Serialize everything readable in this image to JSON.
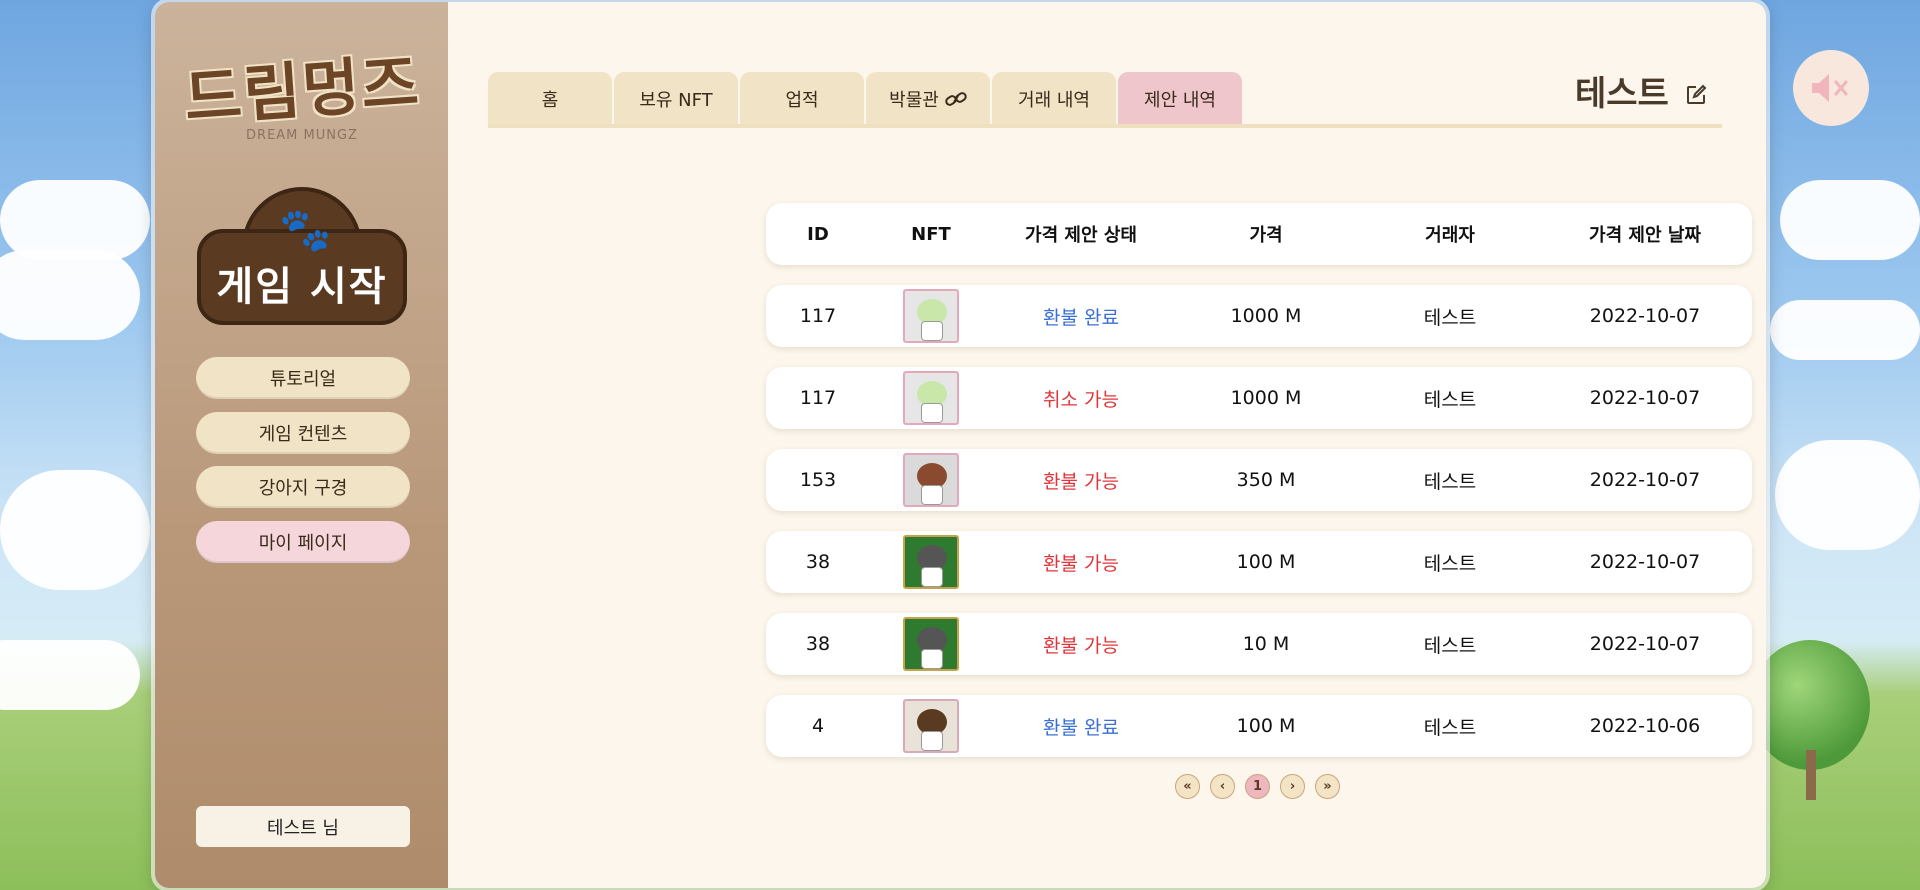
{
  "logo": {
    "text": "드림멍즈",
    "subtitle": "DREAM MUNGZ"
  },
  "sidebar": {
    "game_start_label": "게임 시작",
    "items": [
      {
        "label": "튜토리얼"
      },
      {
        "label": "게임 컨텐츠"
      },
      {
        "label": "강아지 구경"
      },
      {
        "label": "마이 페이지"
      }
    ],
    "user_label": "테스트 님"
  },
  "tabs": [
    {
      "label": "홈"
    },
    {
      "label": "보유 NFT"
    },
    {
      "label": "업적"
    },
    {
      "label": "박물관"
    },
    {
      "label": "거래 내역"
    },
    {
      "label": "제안 내역"
    }
  ],
  "profile": {
    "name": "테스트"
  },
  "table": {
    "headers": [
      "ID",
      "NFT",
      "가격 제안 상태",
      "가격",
      "거래자",
      "가격 제안 날짜"
    ],
    "rows": [
      {
        "id": "117",
        "status": "환불 완료",
        "status_color": "#3a6fd8",
        "price": "1000 M",
        "trader": "테스트",
        "date": "2022-10-07",
        "thumb": "mint-dog"
      },
      {
        "id": "117",
        "status": "취소 가능",
        "status_color": "#e0353a",
        "price": "1000 M",
        "trader": "테스트",
        "date": "2022-10-07",
        "thumb": "mint-dog"
      },
      {
        "id": "153",
        "status": "환불 가능",
        "status_color": "#e0353a",
        "price": "350 M",
        "trader": "테스트",
        "date": "2022-10-07",
        "thumb": "brown-dog"
      },
      {
        "id": "38",
        "status": "환불 가능",
        "status_color": "#e0353a",
        "price": "100 M",
        "trader": "테스트",
        "date": "2022-10-07",
        "thumb": "gray-dog-green"
      },
      {
        "id": "38",
        "status": "환불 가능",
        "status_color": "#e0353a",
        "price": "10 M",
        "trader": "테스트",
        "date": "2022-10-07",
        "thumb": "gray-dog-green"
      },
      {
        "id": "4",
        "status": "환불 완료",
        "status_color": "#3a6fd8",
        "price": "100 M",
        "trader": "테스트",
        "date": "2022-10-06",
        "thumb": "brown-dog-dark"
      }
    ]
  },
  "pagination": {
    "current": "1",
    "first": "«",
    "prev": "‹",
    "next": "›",
    "last": "»"
  },
  "colors": {
    "accent_pink": "#efc6cc",
    "tab_bg": "#f0e3c6",
    "sidebar_brown": "#b9987a"
  }
}
